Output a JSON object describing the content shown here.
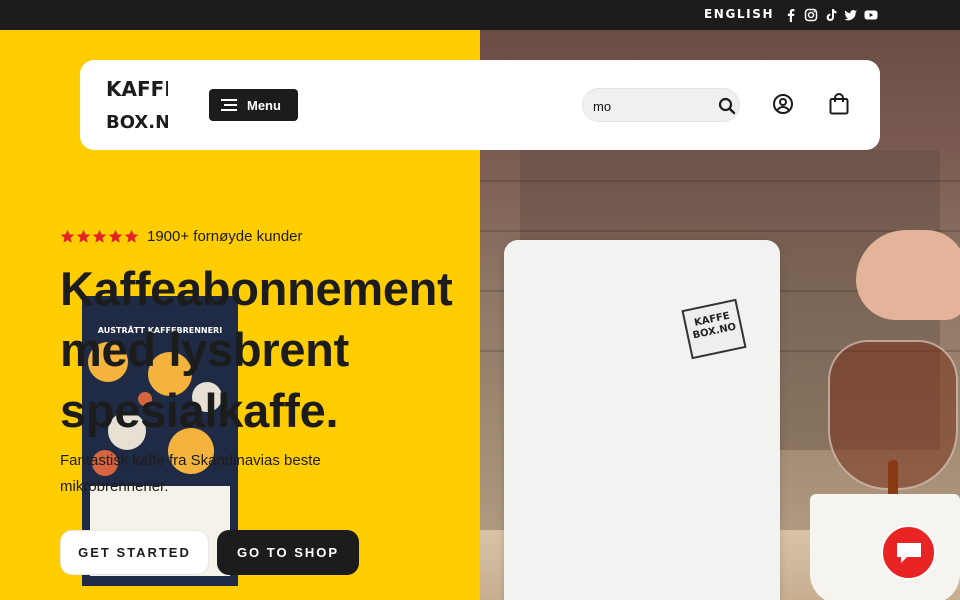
{
  "topbar": {
    "language": "ENGLISH",
    "socials": [
      "facebook-icon",
      "instagram-icon",
      "tiktok-icon",
      "twitter-icon",
      "youtube-icon"
    ]
  },
  "header": {
    "logo_lines": [
      "KAFFE",
      "BOX.NO"
    ],
    "menu_label": "Menu",
    "search": {
      "value": "mo",
      "placeholder": ""
    },
    "icons": [
      "search-icon",
      "account-icon",
      "cart-icon"
    ]
  },
  "hero": {
    "rating_stars": 5,
    "rating_text": "1900+ fornøyde kunder",
    "headline_lines": [
      "Kaffeabonnement",
      "med lysbrent",
      "spesialkaffe."
    ],
    "subtitle": "Fantastisk kaffe fra Skandinavias beste mikrobrennerier.",
    "cta_primary": "GET STARTED",
    "cta_secondary": "GO TO SHOP"
  },
  "photo": {
    "bag_roaster": "AUSTRÅTT KAFFEBRENNERI",
    "sticker": "KAFFE BOX.NO"
  },
  "colors": {
    "brand_yellow": "#ffcd00",
    "dark": "#1c1c1c",
    "chat_red": "#e82424",
    "star_red": "#e02424"
  },
  "chat": {
    "icon": "chat-bubble-icon"
  }
}
